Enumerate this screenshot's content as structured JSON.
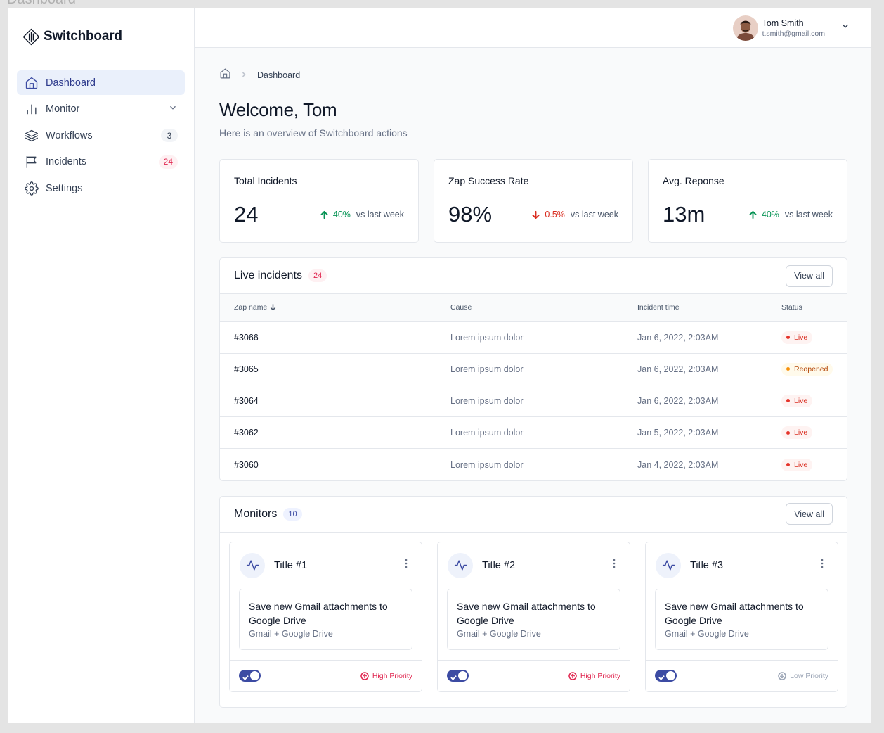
{
  "canvas": {
    "title": "Dashboard"
  },
  "app": {
    "name": "Switchboard"
  },
  "sidebar": {
    "items": [
      {
        "label": "Dashboard",
        "icon": "home-icon",
        "active": true
      },
      {
        "label": "Monitor",
        "icon": "bar-chart-icon",
        "has_chevron": true
      },
      {
        "label": "Workflows",
        "icon": "layers-icon",
        "badge": "3"
      },
      {
        "label": "Incidents",
        "icon": "flag-icon",
        "badge": "24"
      },
      {
        "label": "Settings",
        "icon": "gear-icon"
      }
    ]
  },
  "user": {
    "name": "Tom Smith",
    "email": "t.smith@gmail.com"
  },
  "breadcrumb": {
    "current": "Dashboard"
  },
  "page": {
    "title": "Welcome, Tom",
    "subtitle": "Here is an overview of Switchboard actions"
  },
  "stats": [
    {
      "label": "Total Incidents",
      "value": "24",
      "trend": "40%",
      "direction": "up",
      "note": "vs last week"
    },
    {
      "label": "Zap Success Rate",
      "value": "98%",
      "trend": "0.5%",
      "direction": "down",
      "note": "vs last week"
    },
    {
      "label": "Avg. Reponse",
      "value": "13m",
      "trend": "40%",
      "direction": "up",
      "note": "vs last week"
    }
  ],
  "incidents": {
    "title": "Live incidents",
    "count": "24",
    "view_all": "View all",
    "columns": [
      "Zap name",
      "Cause",
      "Incident time",
      "Status"
    ],
    "rows": [
      {
        "zap": "#3066",
        "cause": "Lorem ipsum dolor",
        "time": "Jan 6, 2022, 2:03AM",
        "status": "Live"
      },
      {
        "zap": "#3065",
        "cause": "Lorem ipsum dolor",
        "time": "Jan 6, 2022, 2:03AM",
        "status": "Reopened"
      },
      {
        "zap": "#3064",
        "cause": "Lorem ipsum dolor",
        "time": "Jan 6, 2022, 2:03AM",
        "status": "Live"
      },
      {
        "zap": "#3062",
        "cause": "Lorem ipsum dolor",
        "time": "Jan 5, 2022, 2:03AM",
        "status": "Live"
      },
      {
        "zap": "#3060",
        "cause": "Lorem ipsum dolor",
        "time": "Jan 4, 2022, 2:03AM",
        "status": "Live"
      }
    ]
  },
  "monitors": {
    "title": "Monitors",
    "count": "10",
    "view_all": "View all",
    "items": [
      {
        "title": "Title #1",
        "desc": "Save new Gmail attachments to Google Drive",
        "apps": "Gmail + Google Drive",
        "enabled": true,
        "priority": "High Priority",
        "level": "high"
      },
      {
        "title": "Title #2",
        "desc": "Save new Gmail attachments to Google Drive",
        "apps": "Gmail + Google Drive",
        "enabled": true,
        "priority": "High Priority",
        "level": "high"
      },
      {
        "title": "Title #3",
        "desc": "Save new Gmail attachments to Google Drive",
        "apps": "Gmail + Google Drive",
        "enabled": true,
        "priority": "Low Priority",
        "level": "low"
      }
    ]
  },
  "colors": {
    "accent": "#3c4ba3",
    "active_bg": "#eaf0fb",
    "danger": "#e0244e",
    "success": "#079455",
    "warning": "#b54708"
  }
}
